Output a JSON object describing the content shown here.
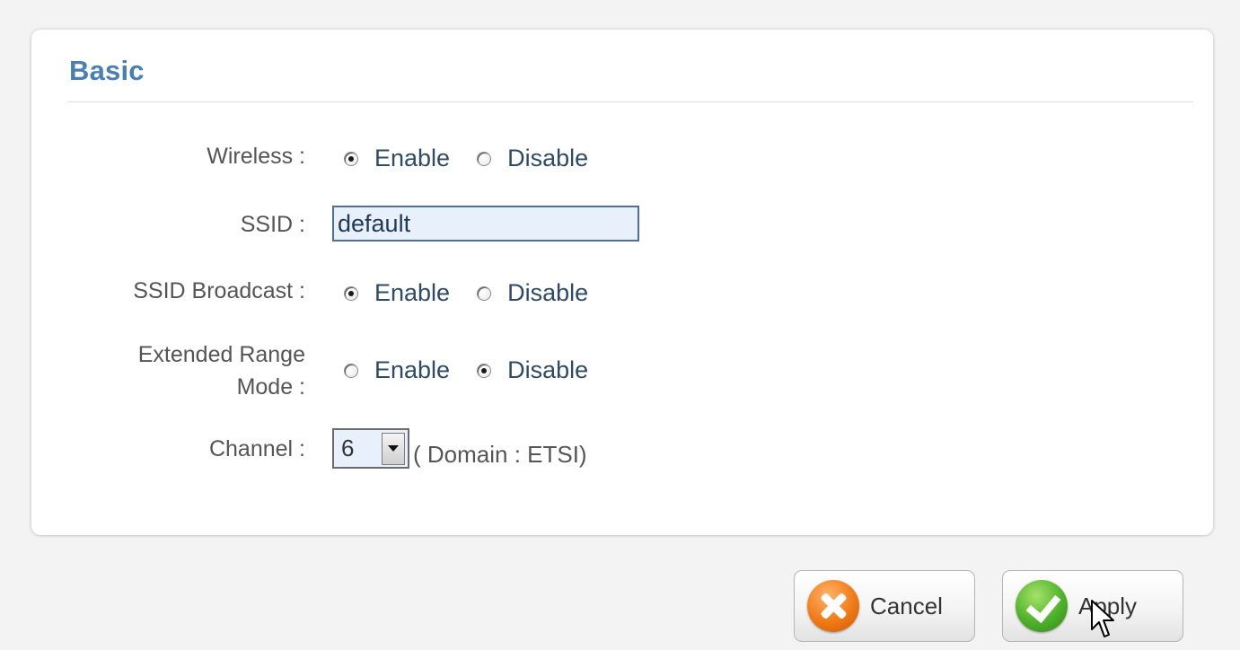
{
  "panel": {
    "title": "Basic"
  },
  "rows": {
    "wireless": {
      "label": "Wireless :",
      "options": [
        "Enable",
        "Disable"
      ],
      "selected": "Enable"
    },
    "ssid": {
      "label": "SSID :",
      "value": "default"
    },
    "ssid_broadcast": {
      "label": "SSID Broadcast :",
      "options": [
        "Enable",
        "Disable"
      ],
      "selected": "Enable"
    },
    "extended_range": {
      "label_line1": "Extended Range",
      "label_line2": "Mode :",
      "options": [
        "Enable",
        "Disable"
      ],
      "selected": "Disable"
    },
    "channel": {
      "label": "Channel :",
      "value": "6",
      "domain_text": "( Domain : ETSI)"
    }
  },
  "buttons": {
    "cancel_label": "Cancel",
    "apply_label": "Apply"
  },
  "colors": {
    "title": "#4a7fb5",
    "input_bg": "#e8f0fb",
    "cancel_icon": "#f07a16",
    "apply_icon": "#4fb12a"
  },
  "icons": {
    "cancel": "x-circle-icon",
    "apply": "check-circle-icon",
    "cursor": "mouse-pointer-icon",
    "select": "chevron-down-icon"
  }
}
